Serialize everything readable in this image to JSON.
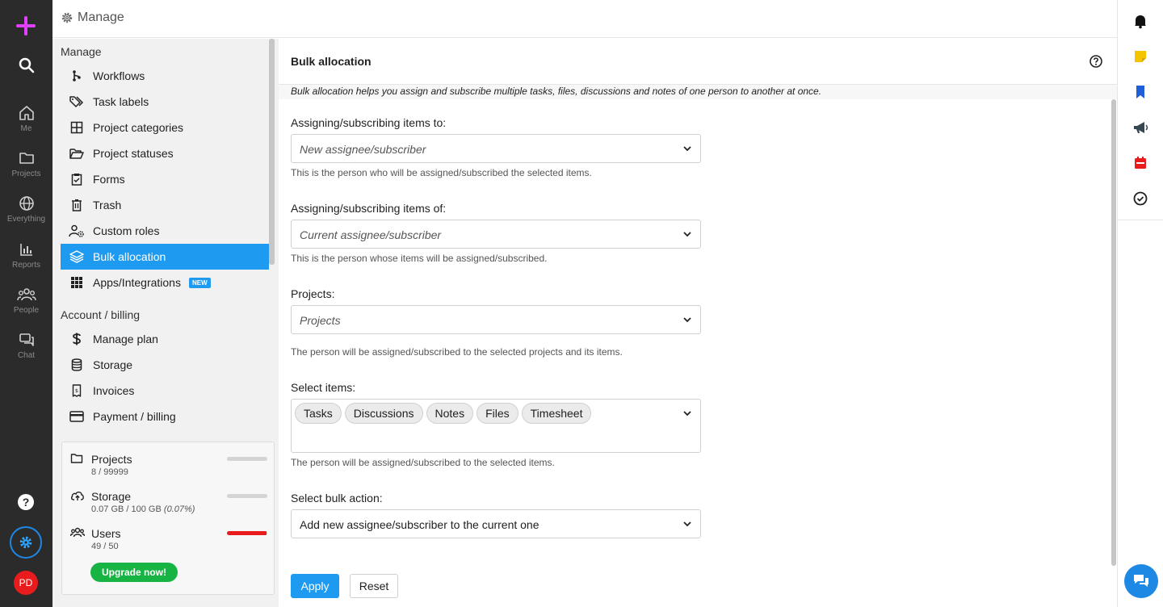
{
  "app": {
    "header_title": "Manage",
    "user_initials": "PD"
  },
  "rail": {
    "items": [
      {
        "label": "Me",
        "icon": "home-icon"
      },
      {
        "label": "Projects",
        "icon": "folder-icon"
      },
      {
        "label": "Everything",
        "icon": "globe-icon"
      },
      {
        "label": "Reports",
        "icon": "bar-chart-icon"
      },
      {
        "label": "People",
        "icon": "people-icon"
      },
      {
        "label": "Chat",
        "icon": "chat-icon"
      }
    ],
    "help_glyph": "?"
  },
  "sidebar": {
    "section_manage": "Manage",
    "manage_items": [
      {
        "label": "Workflows",
        "icon": "workflow-icon"
      },
      {
        "label": "Task labels",
        "icon": "tag-icon"
      },
      {
        "label": "Project categories",
        "icon": "grid-icon"
      },
      {
        "label": "Project statuses",
        "icon": "folder-open-icon"
      },
      {
        "label": "Forms",
        "icon": "clipboard-icon"
      },
      {
        "label": "Trash",
        "icon": "trash-icon"
      },
      {
        "label": "Custom roles",
        "icon": "user-settings-icon"
      },
      {
        "label": "Bulk allocation",
        "icon": "layers-icon",
        "active": true
      },
      {
        "label": "Apps/Integrations",
        "icon": "apps-icon",
        "badge": "NEW"
      }
    ],
    "section_account": "Account / billing",
    "account_items": [
      {
        "label": "Manage plan",
        "icon": "dollar-icon"
      },
      {
        "label": "Storage",
        "icon": "database-icon"
      },
      {
        "label": "Invoices",
        "icon": "invoice-icon"
      },
      {
        "label": "Payment / billing",
        "icon": "credit-card-icon"
      }
    ],
    "usage": {
      "projects": {
        "label": "Projects",
        "value": "8 / 99999",
        "fraction": 0.0001
      },
      "storage": {
        "label": "Storage",
        "value": "0.07 GB / 100 GB",
        "percent_text": "(0.07%)",
        "fraction": 0.0007
      },
      "users": {
        "label": "Users",
        "value": "49 / 50",
        "fraction": 0.98
      },
      "upgrade_label": "Upgrade now!",
      "colors": {
        "track": "#d4d4d4",
        "fill_full": "#e81c1c",
        "upgrade": "#17b343"
      }
    }
  },
  "main": {
    "title": "Bulk allocation",
    "intro": "Bulk allocation helps you assign and subscribe multiple tasks, files, discussions and notes of one person to another at once.",
    "fields": {
      "to": {
        "label": "Assigning/subscribing items to:",
        "placeholder": "New assignee/subscriber",
        "hint": "This is the person who will be assigned/subscribed the selected items."
      },
      "of": {
        "label": "Assigning/subscribing items of:",
        "placeholder": "Current assignee/subscriber",
        "hint": "This is the person whose items will be assigned/subscribed."
      },
      "projects": {
        "label": "Projects:",
        "placeholder": "Projects",
        "hint": "The person will be assigned/subscribed to the selected projects and its items."
      },
      "items": {
        "label": "Select items:",
        "chips": [
          "Tasks",
          "Discussions",
          "Notes",
          "Files",
          "Timesheet"
        ],
        "hint": "The person will be assigned/subscribed to the selected items."
      },
      "action": {
        "label": "Select bulk action:",
        "value": "Add new assignee/subscriber to the current one"
      }
    },
    "apply_label": "Apply",
    "reset_label": "Reset",
    "accent": "#1e9bf0"
  },
  "right_toolbar": {
    "icons": [
      "bell-icon",
      "sticky-note-icon",
      "bookmark-icon",
      "megaphone-icon",
      "calendar-icon",
      "check-circle-icon"
    ],
    "colors": {
      "bell": "#111111",
      "sticky_note": "#f5c400",
      "bookmark": "#1e5ed6",
      "megaphone": "#37474f",
      "calendar": "#e81c1c",
      "check_circle": "#222222"
    }
  }
}
